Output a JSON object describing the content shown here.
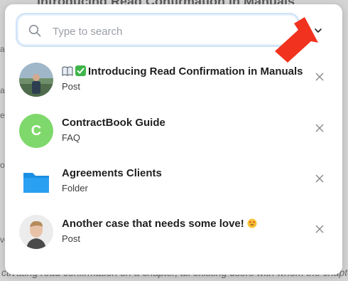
{
  "background": {
    "title": "Introducing Read Confirmation in Manuals",
    "bottom_text": "ctivating read confirmation on a chapter, all existing users with whom the chapter is shared"
  },
  "search": {
    "placeholder": "Type to search",
    "value": ""
  },
  "results": [
    {
      "title": "Introducing Read Confirmation in Manuals",
      "type": "Post",
      "prefix_icons": [
        "book-icon",
        "checkmark-icon"
      ]
    },
    {
      "title": "ContractBook Guide",
      "type": "FAQ",
      "avatar_letter": "C",
      "avatar_color": "#7fd86b"
    },
    {
      "title": "Agreements Clients",
      "type": "Folder",
      "icon": "folder-icon",
      "icon_color": "#1a8fe3"
    },
    {
      "title": "Another case that needs some love!",
      "type": "Post",
      "suffix_icon": "heart-eyes-emoji-icon"
    }
  ],
  "colors": {
    "accent": "#1a8fe3",
    "arrow": "#f0321e",
    "focus_ring": "#cfe2f7"
  }
}
